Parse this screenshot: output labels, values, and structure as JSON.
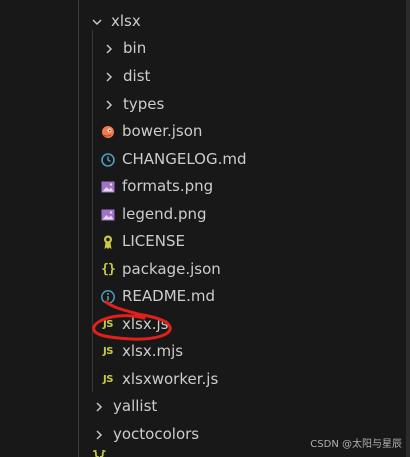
{
  "explorer": {
    "root_folder": {
      "label": "xlsx",
      "expanded": true,
      "icon": "chevron-down-icon"
    },
    "children": [
      {
        "label": "bin",
        "kind": "folder",
        "icon": "chevron-right-icon"
      },
      {
        "label": "dist",
        "kind": "folder",
        "icon": "chevron-right-icon"
      },
      {
        "label": "types",
        "kind": "folder",
        "icon": "chevron-right-icon"
      },
      {
        "label": "bower.json",
        "kind": "file",
        "icon": "bower-icon",
        "color": "#ef7b4f"
      },
      {
        "label": "CHANGELOG.md",
        "kind": "file",
        "icon": "clock-icon",
        "color": "#519aba"
      },
      {
        "label": "formats.png",
        "kind": "file",
        "icon": "image-icon",
        "color": "#a074c4"
      },
      {
        "label": "legend.png",
        "kind": "file",
        "icon": "image-icon",
        "color": "#a074c4"
      },
      {
        "label": "LICENSE",
        "kind": "file",
        "icon": "license-icon",
        "color": "#cbcb41"
      },
      {
        "label": "package.json",
        "kind": "file",
        "icon": "braces-icon",
        "glyph": "{}",
        "color": "#cbcb41"
      },
      {
        "label": "README.md",
        "kind": "file",
        "icon": "info-icon",
        "color": "#519aba"
      },
      {
        "label": "xlsx.js",
        "kind": "file",
        "icon": "js-icon",
        "glyph": "JS",
        "color": "#cbcb41",
        "annotated": true
      },
      {
        "label": "xlsx.mjs",
        "kind": "file",
        "icon": "js-icon",
        "glyph": "JS",
        "color": "#cbcb41"
      },
      {
        "label": "xlsxworker.js",
        "kind": "file",
        "icon": "js-icon",
        "glyph": "JS",
        "color": "#cbcb41"
      }
    ],
    "siblings": [
      {
        "label": "yallist",
        "kind": "folder",
        "icon": "chevron-right-icon"
      },
      {
        "label": "yoctocolors",
        "kind": "folder",
        "icon": "chevron-right-icon"
      }
    ],
    "partial_next": {
      "glyph": "{}"
    }
  },
  "colors": {
    "background": "#181818",
    "text": "#cccccc",
    "indent_guide": "#3a3a3a",
    "annotation": "#e0201a"
  },
  "watermark": "CSDN @太阳与星辰"
}
